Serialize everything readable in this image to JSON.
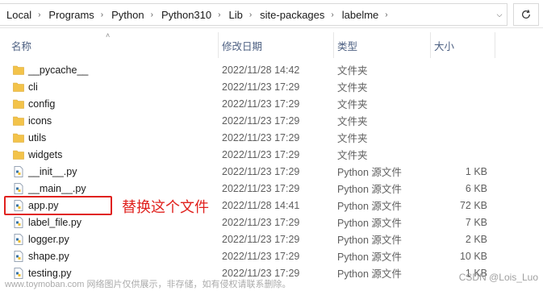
{
  "address": {
    "crumbs": [
      "Local",
      "Programs",
      "Python",
      "Python310",
      "Lib",
      "site-packages",
      "labelme"
    ]
  },
  "header": {
    "name": "名称",
    "date": "修改日期",
    "type": "类型",
    "size": "大小"
  },
  "files": [
    {
      "name": "__pycache__",
      "date": "2022/11/28 14:42",
      "type": "文件夹",
      "size": "",
      "kind": "folder"
    },
    {
      "name": "cli",
      "date": "2022/11/23 17:29",
      "type": "文件夹",
      "size": "",
      "kind": "folder"
    },
    {
      "name": "config",
      "date": "2022/11/23 17:29",
      "type": "文件夹",
      "size": "",
      "kind": "folder"
    },
    {
      "name": "icons",
      "date": "2022/11/23 17:29",
      "type": "文件夹",
      "size": "",
      "kind": "folder"
    },
    {
      "name": "utils",
      "date": "2022/11/23 17:29",
      "type": "文件夹",
      "size": "",
      "kind": "folder"
    },
    {
      "name": "widgets",
      "date": "2022/11/23 17:29",
      "type": "文件夹",
      "size": "",
      "kind": "folder"
    },
    {
      "name": "__init__.py",
      "date": "2022/11/23 17:29",
      "type": "Python 源文件",
      "size": "1 KB",
      "kind": "py"
    },
    {
      "name": "__main__.py",
      "date": "2022/11/23 17:29",
      "type": "Python 源文件",
      "size": "6 KB",
      "kind": "py"
    },
    {
      "name": "app.py",
      "date": "2022/11/28 14:41",
      "type": "Python 源文件",
      "size": "72 KB",
      "kind": "py"
    },
    {
      "name": "label_file.py",
      "date": "2022/11/23 17:29",
      "type": "Python 源文件",
      "size": "7 KB",
      "kind": "py"
    },
    {
      "name": "logger.py",
      "date": "2022/11/23 17:29",
      "type": "Python 源文件",
      "size": "2 KB",
      "kind": "py"
    },
    {
      "name": "shape.py",
      "date": "2022/11/23 17:29",
      "type": "Python 源文件",
      "size": "10 KB",
      "kind": "py"
    },
    {
      "name": "testing.py",
      "date": "2022/11/23 17:29",
      "type": "Python 源文件",
      "size": "1 KB",
      "kind": "py"
    }
  ],
  "annotation": "替换这个文件",
  "watermark": "www.toymoban.com 网络图片仅供展示，非存储，如有侵权请联系删除。",
  "watermark_right": "CSDN @Lois_Luo",
  "colors": {
    "folder": "#f3c34a",
    "annotation": "#e0211d",
    "header_text": "#4d6082"
  }
}
